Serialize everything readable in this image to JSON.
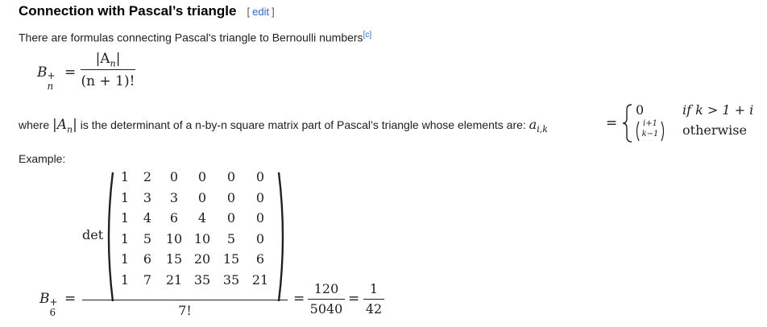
{
  "section": {
    "title": "Connection with Pascal’s triangle",
    "edit_open": "[",
    "edit_label": "edit",
    "edit_close": "]"
  },
  "intro": {
    "text": "There are formulas connecting Pascal's triangle to Bernoulli numbers",
    "footnote": "[c]"
  },
  "formula1": {
    "lhs_symbol": "B",
    "lhs_sup": "+",
    "lhs_sub": "n",
    "equals": "=",
    "numerator": "|A",
    "numerator_sub": "n",
    "numerator_close": "|",
    "denominator": "(n + 1)!"
  },
  "definition": {
    "prefix": "where ",
    "abs_open": "|",
    "symbol": "A",
    "symbol_sub": "n",
    "abs_close": "|",
    "text": " is the determinant of a n-by-n square matrix part of Pascal’s triangle whose elements are: ",
    "elem_symbol": "a",
    "elem_sub": "i,k",
    "equals": "=",
    "case1_value": "0",
    "case1_condition": "if k > 1 + i",
    "case2_binom_top": "i+1",
    "case2_binom_bottom": "k−1",
    "case2_condition": "otherwise"
  },
  "example": {
    "label": "Example:",
    "lhs_symbol": "B",
    "lhs_sup": "+",
    "lhs_sub": "6",
    "equals": "=",
    "det_label": "det",
    "matrix": [
      [
        "1",
        "2",
        "0",
        "0",
        "0",
        "0"
      ],
      [
        "1",
        "3",
        "3",
        "0",
        "0",
        "0"
      ],
      [
        "1",
        "4",
        "6",
        "4",
        "0",
        "0"
      ],
      [
        "1",
        "5",
        "10",
        "10",
        "5",
        "0"
      ],
      [
        "1",
        "6",
        "15",
        "20",
        "15",
        "6"
      ],
      [
        "1",
        "7",
        "21",
        "35",
        "35",
        "21"
      ]
    ],
    "denominator": "7!",
    "equals2": "=",
    "frac2_num": "120",
    "frac2_den": "5040",
    "equals3": "=",
    "frac3_num": "1",
    "frac3_den": "42"
  }
}
